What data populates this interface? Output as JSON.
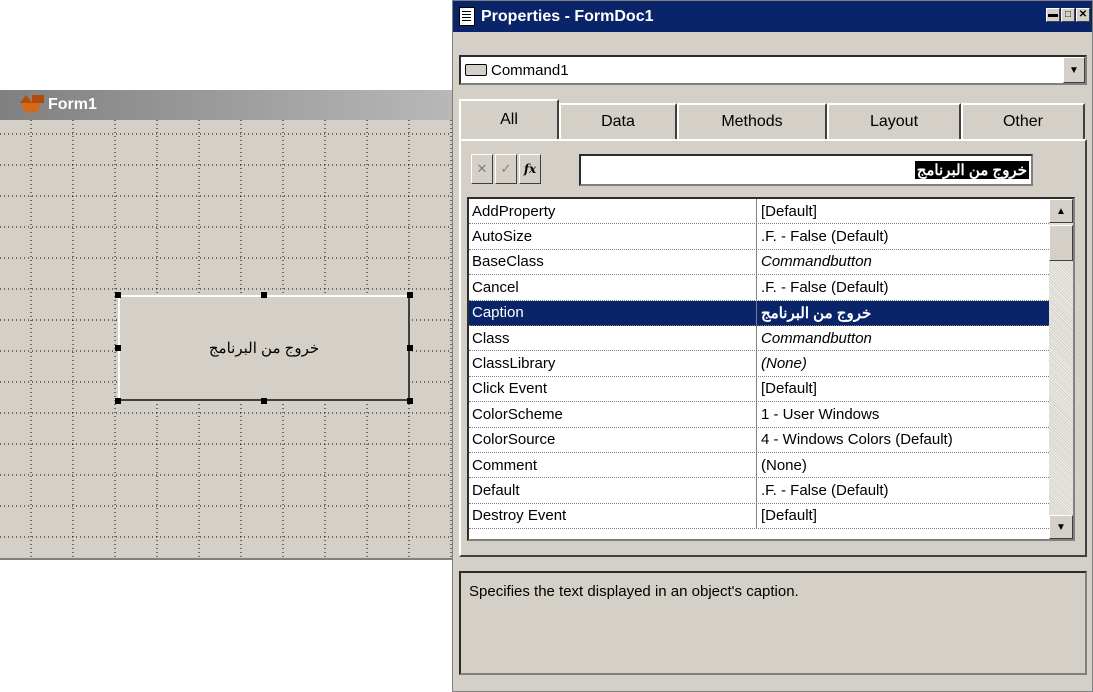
{
  "form": {
    "title": "Form1",
    "button_caption": "خروج من البرنامج"
  },
  "properties": {
    "title": "Properties - FormDoc1",
    "object_combo": "Command1",
    "tabs": [
      "All",
      "Data",
      "Methods",
      "Layout",
      "Other"
    ],
    "active_tab": "All",
    "edit_value": "خروج من البرنامج",
    "rows": [
      {
        "name": "AddProperty",
        "value": "[Default]"
      },
      {
        "name": "AutoSize",
        "value": ".F. - False (Default)"
      },
      {
        "name": "BaseClass",
        "value": "Commandbutton"
      },
      {
        "name": "Cancel",
        "value": ".F. - False (Default)"
      },
      {
        "name": "Caption",
        "value": "خروج من البرنامج"
      },
      {
        "name": "Class",
        "value": "Commandbutton"
      },
      {
        "name": "ClassLibrary",
        "value": "(None)"
      },
      {
        "name": "Click Event",
        "value": "[Default]"
      },
      {
        "name": "ColorScheme",
        "value": "1 - User Windows"
      },
      {
        "name": "ColorSource",
        "value": "4 - Windows Colors (Default)"
      },
      {
        "name": "Comment",
        "value": "(None)"
      },
      {
        "name": "Default",
        "value": ".F. - False (Default)"
      },
      {
        "name": "Destroy Event",
        "value": "[Default]"
      }
    ],
    "selected_row": "Caption",
    "description": "Specifies the text displayed in an object's caption."
  },
  "colors": {
    "titlebar_active": "#0a246a",
    "titlebar_inactive": "#808080",
    "face": "#d4d0c8"
  }
}
